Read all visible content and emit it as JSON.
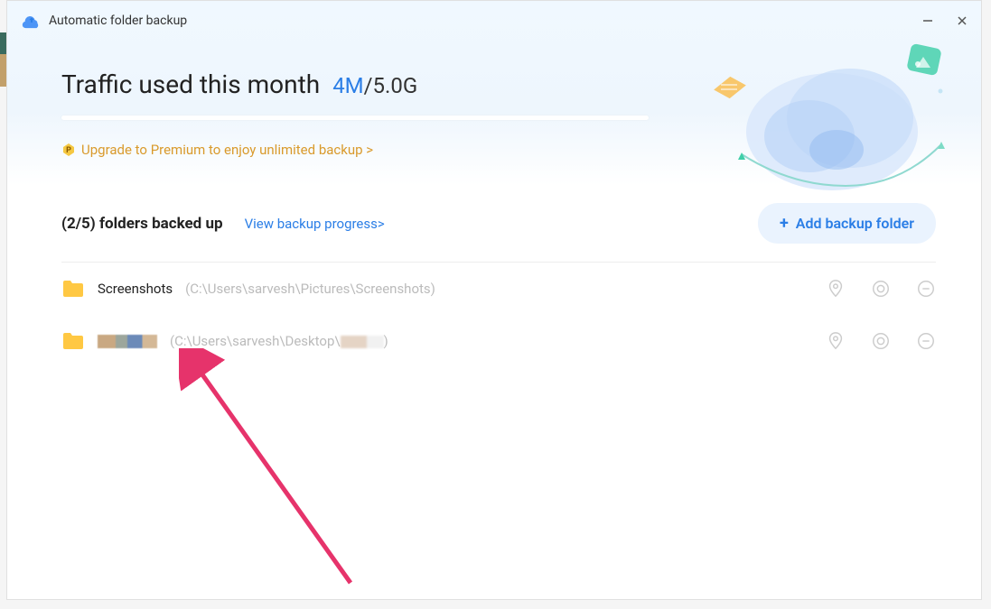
{
  "titlebar": {
    "title": "Automatic folder backup"
  },
  "traffic": {
    "title": "Traffic used this month",
    "used": "4M",
    "separator": "/",
    "total": "5.0G"
  },
  "upgrade": {
    "text": "Upgrade to Premium to enjoy unlimited backup >"
  },
  "folders_header": {
    "count_label": "(2/5) folders backed up",
    "view_progress": "View backup progress>",
    "add_button": "Add backup folder"
  },
  "folders": [
    {
      "name": "Screenshots",
      "path": "(C:\\Users\\sarvesh\\Pictures\\Screenshots)"
    },
    {
      "name_blurred": true,
      "path_prefix": "(C:\\Users\\sarvesh\\Desktop\\",
      "path_suffix": ")"
    }
  ],
  "icons": {
    "plus": "+"
  }
}
